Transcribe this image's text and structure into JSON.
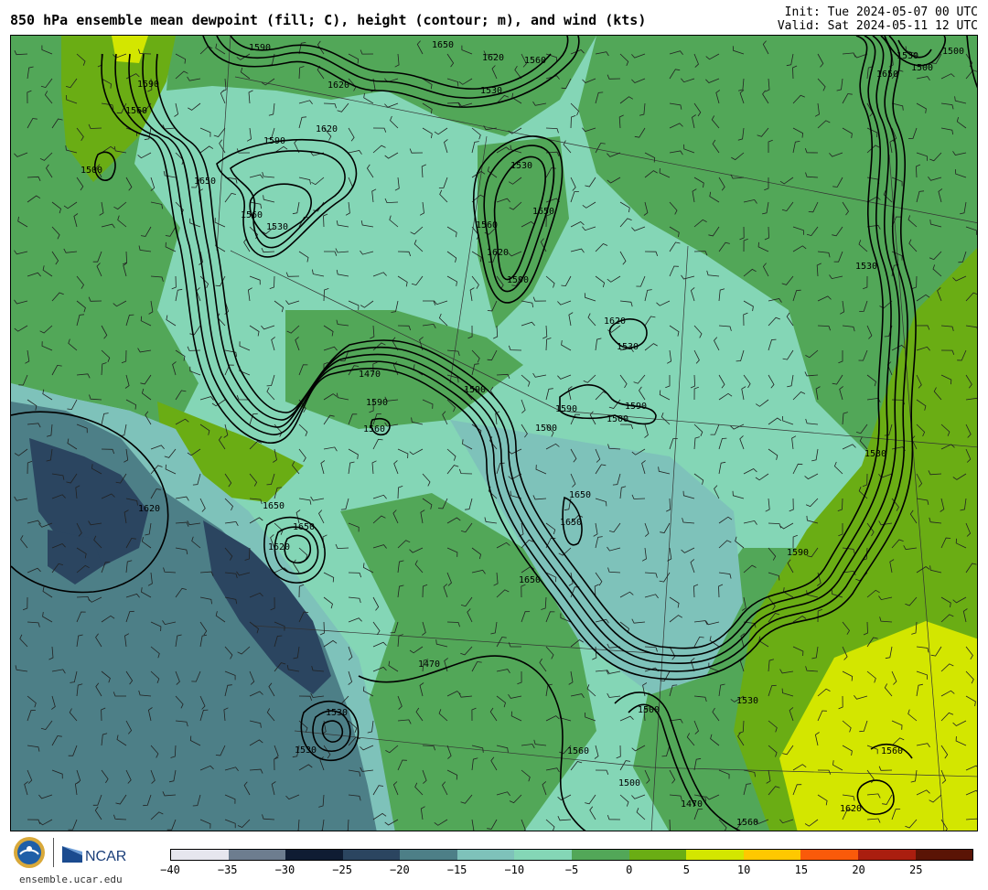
{
  "header": {
    "title": "850 hPa ensemble mean dewpoint (fill; C), height (contour; m), and wind (kts)",
    "init": "Init: Tue 2024-05-07 00 UTC",
    "valid": "Valid: Sat 2024-05-11 12 UTC"
  },
  "colorbar": {
    "colors": [
      "#e6e6ee",
      "#6d7d8f",
      "#0f1c33",
      "#2b4560",
      "#4d7f87",
      "#7ec2ba",
      "#84d6b6",
      "#52a758",
      "#6aad14",
      "#d3e600",
      "#ffc800",
      "#fa5a0a",
      "#aa1e0f",
      "#5a1405"
    ],
    "tick_labels": [
      "−40",
      "−35",
      "−30",
      "−25",
      "−20",
      "−15",
      "−10",
      "−5",
      "0",
      "5",
      "10",
      "15",
      "20",
      "25"
    ]
  },
  "contour_labels": [
    "1590",
    "1620",
    "1650",
    "1620",
    "1530",
    "1560",
    "1590",
    "1560",
    "1500",
    "1590",
    "1620",
    "1650",
    "1560",
    "1530",
    "1530",
    "1560",
    "1590",
    "1620",
    "1650",
    "1620",
    "1530",
    "1590",
    "1500",
    "1470",
    "1590",
    "1560",
    "1590",
    "1650",
    "1620",
    "1650",
    "1650",
    "1620",
    "1650",
    "1470",
    "1500",
    "1560",
    "1530",
    "1530",
    "1500",
    "1470",
    "1560",
    "1590",
    "1530",
    "1530",
    "1650",
    "1500",
    "1500",
    "1530",
    "1560",
    "1620",
    "1530",
    "1650",
    "1590",
    "1500"
  ],
  "footer": {
    "site": "ensemble.ucar.edu",
    "org": "NCAR"
  }
}
